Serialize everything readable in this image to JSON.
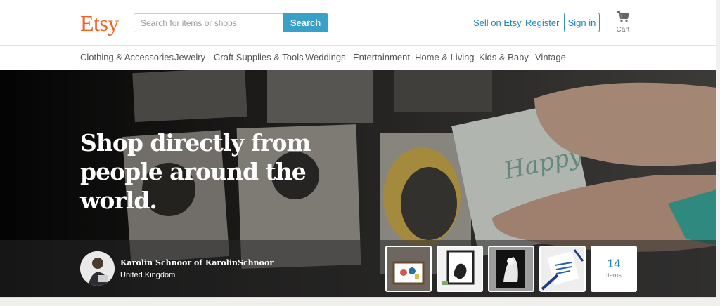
{
  "header": {
    "logo": "Etsy",
    "search_placeholder": "Search for items or shops",
    "search_button": "Search",
    "sell_link": "Sell on Etsy",
    "register_link": "Register",
    "sign_in": "Sign in",
    "cart_label": "Cart",
    "cart_icon": "cart-icon"
  },
  "nav": {
    "items": [
      {
        "label": "Clothing & Accessories"
      },
      {
        "label": "Jewelry"
      },
      {
        "label": "Craft Supplies & Tools"
      },
      {
        "label": "Weddings"
      },
      {
        "label": "Entertainment"
      },
      {
        "label": "Home & Living"
      },
      {
        "label": "Kids & Baby"
      },
      {
        "label": "Vintage"
      }
    ]
  },
  "hero": {
    "title": "Shop directly from people around the world."
  },
  "featured_seller": {
    "name": "Karolin Schnoor of KarolinSchnoor",
    "country": "United Kingdom",
    "items_count": "14",
    "items_label": "items"
  },
  "colors": {
    "brand": "#f1641e",
    "accent": "#39a0c8",
    "link": "#1d84b5"
  }
}
